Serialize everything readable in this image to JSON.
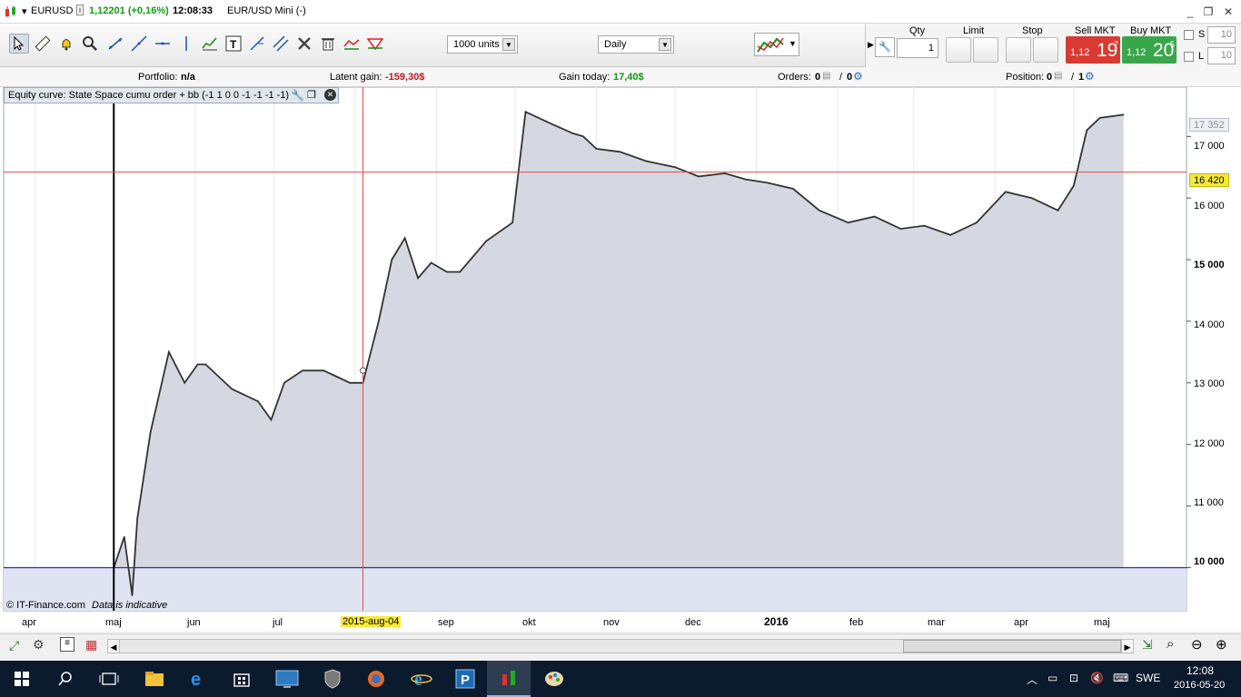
{
  "titlebar": {
    "symbol": "EURUSD",
    "info_glyph": "i",
    "price": "1,12201 (+0,16%)",
    "time": "12:08:33",
    "instrument": "EUR/USD Mini (-)",
    "icons": [
      "candlestick-icon",
      "minimize-icon",
      "restore-icon",
      "close-icon"
    ]
  },
  "toolbar": {
    "tools": [
      "pointer-icon",
      "ruler-icon",
      "alarm-bell-icon",
      "zoom-icon",
      "trendline-icon",
      "line-icon",
      "horizontal-line-icon",
      "vertical-line-icon",
      "indicator-icon",
      "text-tool-icon",
      "fibonacci-icon",
      "channel-icon",
      "tools-icon",
      "trash-icon",
      "zigzag-icon",
      "pattern-icon"
    ],
    "units": "1000 units",
    "period": "Daily",
    "chart_style_icon": "chart-style-icon"
  },
  "order_panel": {
    "qty_label": "Qty",
    "qty_value": "1",
    "limit_label": "Limit",
    "stop_label": "Stop",
    "sell_label": "Sell MKT",
    "sell_small": "1,12",
    "sell_big": "19",
    "sell_sup": "7",
    "buy_label": "Buy MKT",
    "buy_small": "1,12",
    "buy_big": "20",
    "buy_sup": "5",
    "s_label": "S",
    "s_value": "10",
    "l_label": "L",
    "l_value": "10",
    "sell_color": "#d93a32",
    "buy_color": "#3aa64a"
  },
  "info": {
    "portfolio_label": "Portfolio:",
    "portfolio_value": "n/a",
    "latent_label": "Latent gain:",
    "latent_value": "-159,30$",
    "gain_today_label": "Gain today:",
    "gain_today_value": "17,40$",
    "orders_label": "Orders:",
    "orders_a": "0",
    "orders_sep": "/",
    "orders_b": "0",
    "position_label": "Position:",
    "position_a": "0",
    "position_sep": "/",
    "position_b": "1"
  },
  "chart": {
    "legend_text": "Equity curve: State Space cumu order + bb (-1 1 0 0 -1 -1 -1 -1)",
    "crosshair_label": "2015-aug-04",
    "last_value_tag": "17 352",
    "cursor_value_tag": "16 420",
    "y_labels": [
      "17 000",
      "16 000",
      "15 000",
      "14 000",
      "13 000",
      "12 000",
      "11 000",
      "10 000"
    ],
    "month_labels": [
      "apr",
      "maj",
      "jun",
      "jul",
      "sep",
      "okt",
      "nov",
      "dec",
      "2016",
      "feb",
      "mar",
      "apr",
      "maj"
    ],
    "copyright": "© IT-Finance.com",
    "disclaimer": "Data is indicative",
    "line_color": "#333333",
    "fill_color": "#d5d8e0",
    "cursor_color": "#e34b4b",
    "baseline_color": "#2f2f9a"
  },
  "chart_data": {
    "type": "area",
    "title": "Equity curve: State Space cumu order + bb (-1 1 0 0 -1 -1 -1 -1)",
    "xlabel": "",
    "ylabel": "",
    "ylim": [
      9300,
      17800
    ],
    "x": [
      "2015-05-01",
      "2015-05-05",
      "2015-05-08",
      "2015-05-10",
      "2015-05-15",
      "2015-05-22",
      "2015-05-28",
      "2015-06-02",
      "2015-06-05",
      "2015-06-10",
      "2015-06-15",
      "2015-06-20",
      "2015-06-25",
      "2015-06-30",
      "2015-07-05",
      "2015-07-12",
      "2015-07-20",
      "2015-07-25",
      "2015-07-30",
      "2015-08-04",
      "2015-08-10",
      "2015-08-15",
      "2015-08-20",
      "2015-08-25",
      "2015-08-30",
      "2015-09-05",
      "2015-09-10",
      "2015-09-20",
      "2015-09-30",
      "2015-10-05",
      "2015-10-15",
      "2015-10-23",
      "2015-10-27",
      "2015-11-01",
      "2015-11-10",
      "2015-11-20",
      "2015-12-01",
      "2015-12-10",
      "2015-12-20",
      "2015-12-28",
      "2016-01-05",
      "2016-01-15",
      "2016-01-25",
      "2016-02-05",
      "2016-02-15",
      "2016-02-25",
      "2016-03-05",
      "2016-03-15",
      "2016-03-25",
      "2016-04-05",
      "2016-04-15",
      "2016-04-25",
      "2016-05-01",
      "2016-05-06",
      "2016-05-11",
      "2016-05-20"
    ],
    "values": [
      10000,
      10500,
      9550,
      10800,
      12200,
      13500,
      13000,
      13300,
      13300,
      13100,
      12900,
      12800,
      12700,
      12400,
      13000,
      13200,
      13200,
      13100,
      13000,
      13000,
      14000,
      15000,
      15350,
      14700,
      14950,
      14800,
      14800,
      15300,
      15600,
      17400,
      17200,
      17050,
      17000,
      16800,
      16750,
      16600,
      16500,
      16350,
      16400,
      16300,
      16250,
      16150,
      15800,
      15600,
      15700,
      15500,
      15550,
      15400,
      15600,
      16100,
      16000,
      15800,
      16200,
      17100,
      17300,
      17352
    ]
  },
  "bottom_bar": {
    "icons": [
      "expand-icon",
      "indicators-icon",
      "list-icon",
      "layers-icon",
      "scroll-left-icon",
      "scroll-right-icon",
      "zoom-fit-icon",
      "zoom-auto-icon",
      "zoom-out-icon",
      "zoom-in-icon"
    ]
  },
  "taskbar": {
    "icons": [
      "windows-start-icon",
      "search-icon",
      "task-view-icon",
      "file-explorer-icon",
      "edge-icon",
      "store-icon",
      "remote-desktop-icon",
      "shield-app-icon",
      "firefox-icon",
      "internet-explorer-icon",
      "prorealtime-icon",
      "trading-chart-icon",
      "paint-icon"
    ],
    "tray_icons": [
      "chevron-up-icon",
      "battery-icon",
      "network-icon",
      "volume-mute-icon",
      "keyboard-icon"
    ],
    "language": "SWE",
    "clock_time": "12:08",
    "clock_date": "2016-05-20"
  }
}
